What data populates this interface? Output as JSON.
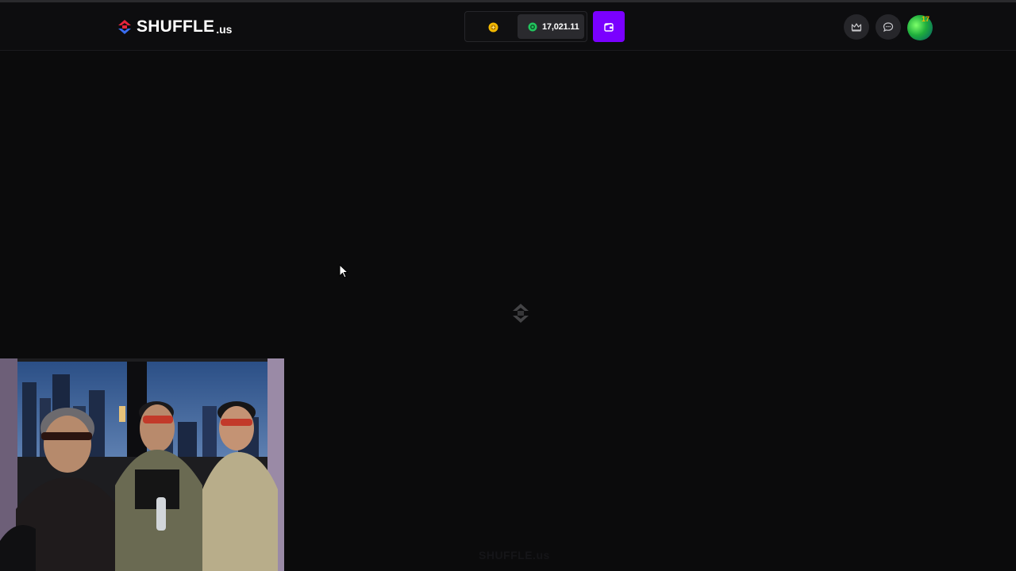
{
  "header": {
    "logo_text": "SHUFFLE",
    "logo_suffix": ".us",
    "balance": "17,021.11",
    "coin_icon": "gold-coin-icon",
    "currency_icon": "green-token-icon",
    "deposit_icon": "wallet-icon",
    "vip_icon": "crown-icon",
    "chat_icon": "chat-bubble-icon",
    "notification_count": "17"
  },
  "main": {
    "spinner_icon": "loading-spinner-icon",
    "footer_watermark": "SHUFFLE.us"
  },
  "colors": {
    "background": "#0b0b0c",
    "accent": "#7a00ff",
    "logo_red": "#e5243b",
    "logo_blue": "#3a6df0",
    "balance_green": "#22c55e"
  }
}
